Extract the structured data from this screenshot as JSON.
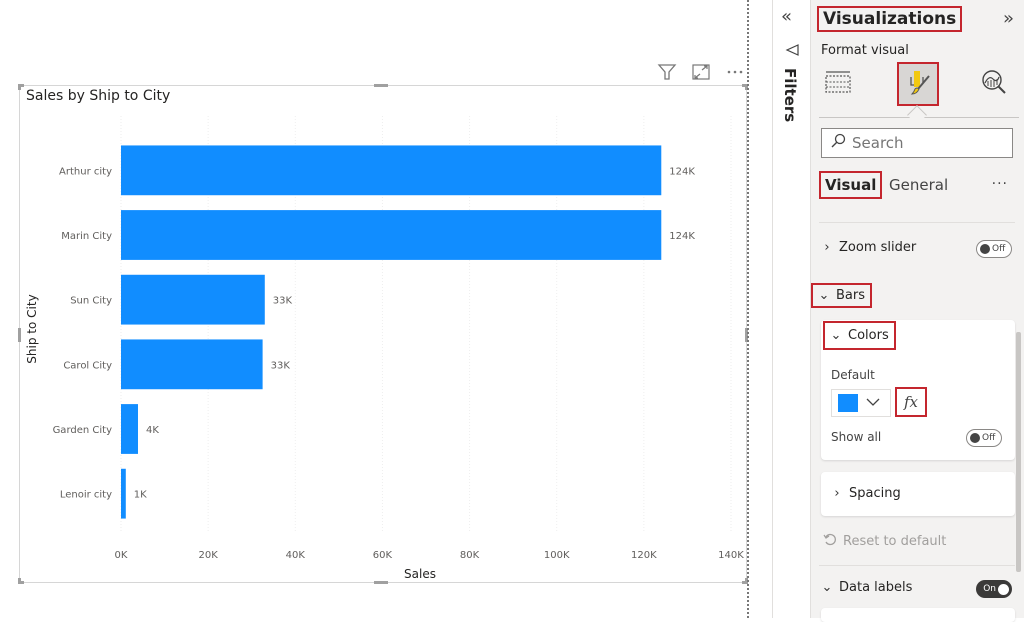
{
  "visual_header": {
    "icons": [
      "filter-icon",
      "focus-mode-icon",
      "more-options-icon"
    ]
  },
  "chart_data": {
    "type": "bar",
    "orientation": "horizontal",
    "title": "Sales by Ship to City",
    "xlabel": "Sales",
    "ylabel": "Ship to City",
    "categories": [
      "Arthur city",
      "Marin City",
      "Sun City",
      "Carol City",
      "Garden City",
      "Lenoir city"
    ],
    "series": [
      {
        "name": "Sales",
        "values": [
          124000,
          124000,
          33000,
          32500,
          3900,
          1100
        ],
        "data_labels": [
          "124K",
          "124K",
          "33K",
          "33K",
          "4K",
          "1K"
        ]
      }
    ],
    "xlim": [
      0,
      140000
    ],
    "xticks": [
      0,
      20000,
      40000,
      60000,
      80000,
      100000,
      120000,
      140000
    ],
    "xtick_labels": [
      "0K",
      "20K",
      "40K",
      "60K",
      "80K",
      "100K",
      "120K",
      "140K"
    ],
    "grid": true,
    "legend": "none",
    "bar_color": "#118DFF"
  },
  "filters_pane": {
    "collapse_icon": "double-chevron-left-icon",
    "label": "Filters"
  },
  "viz_pane": {
    "title": "Visualizations",
    "expand_icon": "double-chevron-right-icon",
    "subtitle": "Format visual",
    "tabs": [
      {
        "name": "build-visual",
        "icon": "fields-icon"
      },
      {
        "name": "format-visual",
        "icon": "paint-roller-icon",
        "active": true
      },
      {
        "name": "analytics",
        "icon": "analytics-magnifier-icon"
      }
    ],
    "search": {
      "placeholder": "Search",
      "value": ""
    },
    "subtabs": {
      "visual": "Visual",
      "general": "General",
      "more": "···"
    },
    "sections": {
      "zoom_slider": {
        "label": "Zoom slider",
        "toggle": "Off",
        "expanded": false
      },
      "bars": {
        "label": "Bars",
        "expanded": true
      },
      "colors": {
        "label": "Colors",
        "expanded": true
      },
      "default_label": "Default",
      "default_color": "#118DFF",
      "fx_label": "fx",
      "show_all": {
        "label": "Show all",
        "toggle": "Off"
      },
      "spacing": {
        "label": "Spacing",
        "expanded": false
      },
      "reset": "Reset to default",
      "data_labels": {
        "label": "Data labels",
        "toggle": "On",
        "expanded": true
      }
    }
  },
  "colors": {
    "highlight_outline": "#C4262E",
    "bar": "#118DFF"
  }
}
